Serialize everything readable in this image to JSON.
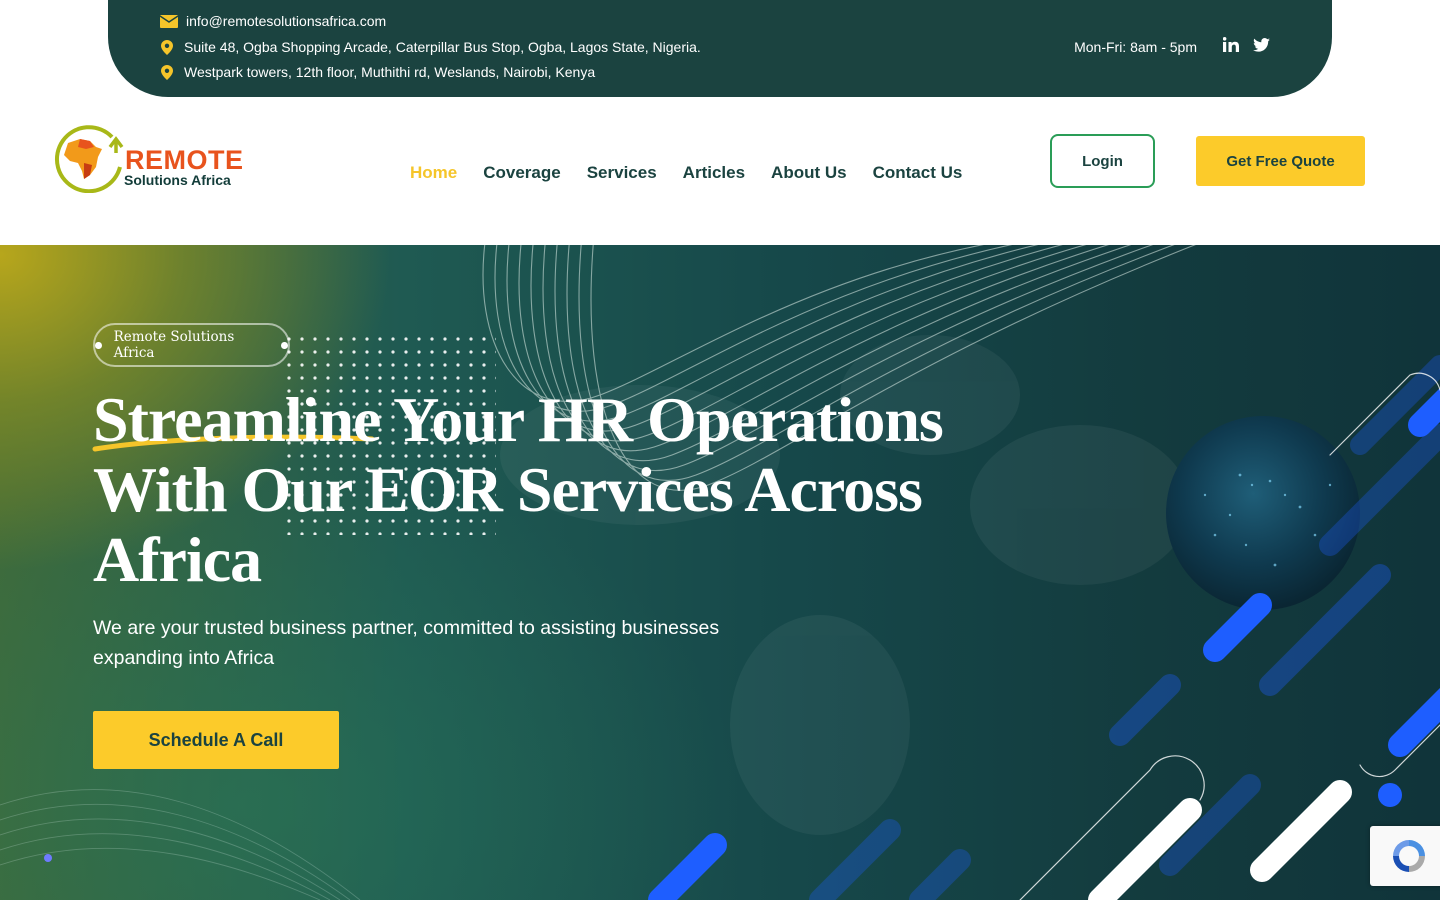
{
  "topbar": {
    "email": "info@remotesolutionsafrica.com",
    "address_1": "Suite 48, Ogba Shopping Arcade, Caterpillar Bus Stop, Ogba, Lagos State, Nigeria.",
    "address_2": "Westpark towers, 12th floor, Muthithi rd, Weslands, Nairobi, Kenya",
    "hours": "Mon-Fri: 8am - 5pm",
    "social": [
      "linkedin-icon",
      "twitter-icon"
    ]
  },
  "header": {
    "logo_line_1": "REMOTE",
    "logo_line_2": "Solutions Africa",
    "nav": [
      {
        "label": "Home",
        "active": true
      },
      {
        "label": "Coverage"
      },
      {
        "label": "Services"
      },
      {
        "label": "Articles"
      },
      {
        "label": "About Us"
      },
      {
        "label": "Contact Us"
      }
    ],
    "login_label": "Login",
    "quote_label": "Get Free Quote"
  },
  "hero": {
    "pill_label": "Remote Solutions Africa",
    "headline_line_1": "Streamline Your HR Operations",
    "headline_line_2": "With Our EOR Services Across",
    "headline_line_3": "Africa",
    "subtext": "We are your trusted business partner, committed to assisting businesses expanding into Africa",
    "cta_label": "Schedule A Call"
  },
  "colors": {
    "topbar_bg": "#1b4340",
    "accent_yellow": "#fccb2a",
    "nav_text": "#1b4340",
    "login_border": "#2a9d57",
    "brand_orange": "#e8531d"
  }
}
